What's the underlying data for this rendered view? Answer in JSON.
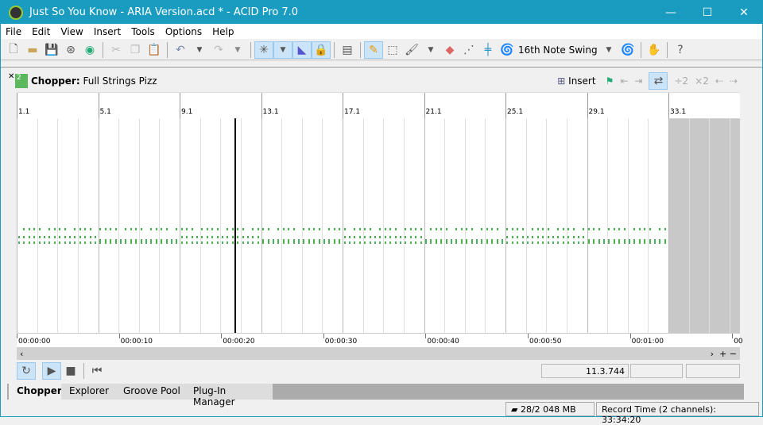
{
  "window": {
    "title": "Just So You Know - ARIA Version.acd * - ACID Pro 7.0",
    "min": "—",
    "max": "☐",
    "close": "✕"
  },
  "menu": [
    "File",
    "Edit",
    "View",
    "Insert",
    "Tools",
    "Options",
    "Help"
  ],
  "toolbar": {
    "groove": "16th Note Swing"
  },
  "chopper": {
    "badge": "2",
    "label": "Chopper:",
    "track": "Full Strings Pizz",
    "insert": "Insert"
  },
  "ruler": [
    "1.1",
    "5.1",
    "9.1",
    "13.1",
    "17.1",
    "21.1",
    "25.1",
    "29.1",
    "33.1"
  ],
  "times": [
    "00:00:00",
    "00:00:10",
    "00:00:20",
    "00:00:30",
    "00:00:40",
    "00:00:50",
    "00:01:00",
    "00"
  ],
  "transport": {
    "position": "11.3.744"
  },
  "tabs": [
    "Chopper",
    "Explorer",
    "Groove Pool",
    "Plug-In Manager"
  ],
  "status": {
    "memory": "28/2 048 MB",
    "record": "Record Time (2 channels): 33:34:20"
  },
  "colors": {
    "titlebar": "#1a9bc0",
    "notes": "#4caf50",
    "selected": "#cce4f7"
  }
}
